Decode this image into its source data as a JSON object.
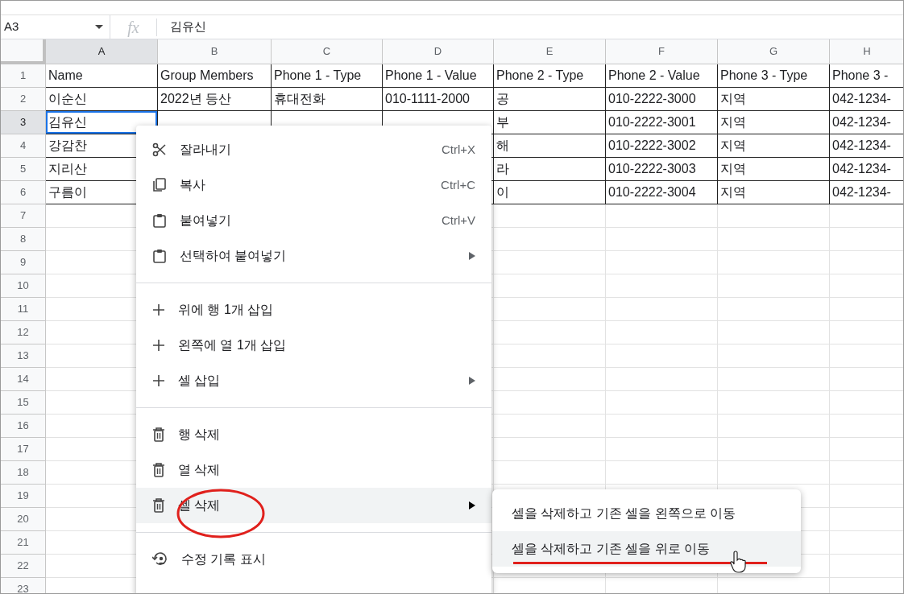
{
  "formula_bar": {
    "cell_ref": "A3",
    "formula_label": "fx",
    "value": "김유신"
  },
  "columns": [
    {
      "letter": "A",
      "selected": true
    },
    {
      "letter": "B",
      "selected": false
    },
    {
      "letter": "C",
      "selected": false
    },
    {
      "letter": "D",
      "selected": false
    },
    {
      "letter": "E",
      "selected": false
    },
    {
      "letter": "F",
      "selected": false
    },
    {
      "letter": "G",
      "selected": false
    },
    {
      "letter": "H",
      "selected": false
    }
  ],
  "rows": [
    {
      "number": "1",
      "selected": false,
      "bordered": true,
      "cells": {
        "A": "Name",
        "B": "Group Members",
        "C": "Phone 1 - Type",
        "D": "Phone 1 - Value",
        "E": "Phone 2 - Type",
        "F": "Phone 2 - Value",
        "G": "Phone 3 - Type",
        "H": "Phone 3 -"
      }
    },
    {
      "number": "2",
      "selected": false,
      "bordered": true,
      "cells": {
        "A": "이순신",
        "B": "2022년 등산",
        "C": "휴대전화",
        "D": "010-1111-2000",
        "E": "공",
        "F": "010-2222-3000",
        "G": "지역",
        "H": "042-1234-"
      }
    },
    {
      "number": "3",
      "selected": true,
      "bordered": true,
      "cells": {
        "A": "김유신",
        "E": "부",
        "F": "010-2222-3001",
        "G": "지역",
        "H": "042-1234-"
      }
    },
    {
      "number": "4",
      "selected": false,
      "bordered": true,
      "cells": {
        "A": "강감찬",
        "E": "해",
        "F": "010-2222-3002",
        "G": "지역",
        "H": "042-1234-"
      }
    },
    {
      "number": "5",
      "selected": false,
      "bordered": true,
      "cells": {
        "A": "지리산",
        "E": "라",
        "F": "010-2222-3003",
        "G": "지역",
        "H": "042-1234-"
      }
    },
    {
      "number": "6",
      "selected": false,
      "bordered": true,
      "cells": {
        "A": "구름이",
        "E": "이",
        "F": "010-2222-3004",
        "G": "지역",
        "H": "042-1234-"
      }
    },
    {
      "number": "7",
      "selected": false,
      "bordered": false,
      "cells": {}
    },
    {
      "number": "8",
      "selected": false,
      "bordered": false,
      "cells": {}
    },
    {
      "number": "9",
      "selected": false,
      "bordered": false,
      "cells": {}
    },
    {
      "number": "10",
      "selected": false,
      "bordered": false,
      "cells": {}
    },
    {
      "number": "11",
      "selected": false,
      "bordered": false,
      "cells": {}
    },
    {
      "number": "12",
      "selected": false,
      "bordered": false,
      "cells": {}
    },
    {
      "number": "13",
      "selected": false,
      "bordered": false,
      "cells": {}
    },
    {
      "number": "14",
      "selected": false,
      "bordered": false,
      "cells": {}
    },
    {
      "number": "15",
      "selected": false,
      "bordered": false,
      "cells": {}
    },
    {
      "number": "16",
      "selected": false,
      "bordered": false,
      "cells": {}
    },
    {
      "number": "17",
      "selected": false,
      "bordered": false,
      "cells": {}
    },
    {
      "number": "18",
      "selected": false,
      "bordered": false,
      "cells": {}
    },
    {
      "number": "19",
      "selected": false,
      "bordered": false,
      "cells": {}
    },
    {
      "number": "20",
      "selected": false,
      "bordered": false,
      "cells": {}
    },
    {
      "number": "21",
      "selected": false,
      "bordered": false,
      "cells": {}
    },
    {
      "number": "22",
      "selected": false,
      "bordered": false,
      "cells": {}
    },
    {
      "number": "23",
      "selected": false,
      "bordered": false,
      "cells": {}
    }
  ],
  "context_menu": {
    "groups": [
      [
        {
          "kind": "cut",
          "label": "잘라내기",
          "shortcut": "Ctrl+X",
          "submenu": false,
          "highlighted": false
        },
        {
          "kind": "copy",
          "label": "복사",
          "shortcut": "Ctrl+C",
          "submenu": false,
          "highlighted": false
        },
        {
          "kind": "paste",
          "label": "붙여넣기",
          "shortcut": "Ctrl+V",
          "submenu": false,
          "highlighted": false
        },
        {
          "kind": "paste",
          "label": "선택하여 붙여넣기",
          "submenu": true,
          "highlighted": false
        }
      ],
      [
        {
          "kind": "insert",
          "label": "위에 행 1개 삽입",
          "submenu": false,
          "highlighted": false
        },
        {
          "kind": "insert",
          "label": "왼쪽에 열 1개 삽입",
          "submenu": false,
          "highlighted": false
        },
        {
          "kind": "insert",
          "label": "셀 삽입",
          "submenu": true,
          "highlighted": false
        }
      ],
      [
        {
          "kind": "delete",
          "label": "행 삭제",
          "submenu": false,
          "highlighted": false
        },
        {
          "kind": "delete",
          "label": "열 삭제",
          "submenu": false,
          "highlighted": false
        },
        {
          "kind": "delete",
          "label": "셀 삭제",
          "submenu": true,
          "highlighted": true
        }
      ],
      [
        {
          "kind": "history",
          "label": "수정 기록 표시",
          "submenu": false,
          "highlighted": false
        }
      ]
    ]
  },
  "submenu": {
    "items": [
      {
        "label": "셀을 삭제하고 기존 셀을 왼쪽으로 이동",
        "highlighted": false
      },
      {
        "label": "셀을 삭제하고 기존 셀을 위로 이동",
        "highlighted": true
      }
    ]
  },
  "annotations": {
    "ellipse": {
      "color": "#e0201c"
    },
    "underline": {
      "color": "#e0201c"
    }
  }
}
